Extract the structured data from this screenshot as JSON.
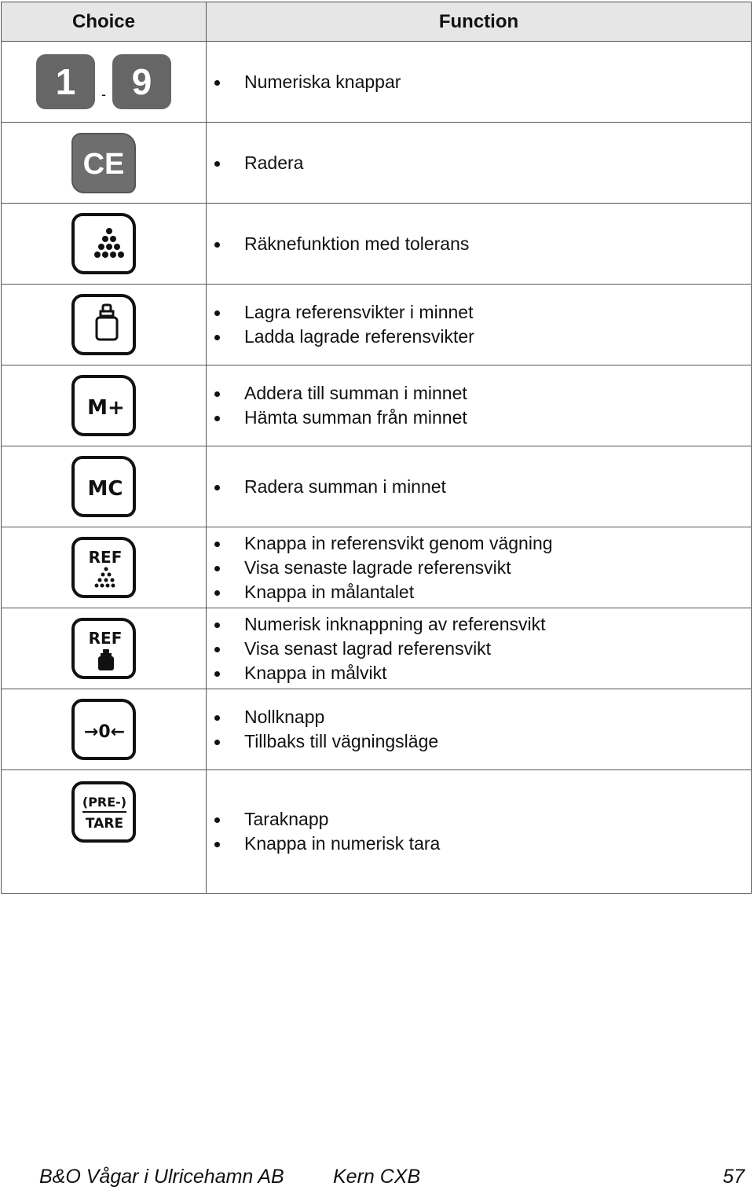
{
  "table": {
    "headers": {
      "choice": "Choice",
      "function": "Function"
    },
    "rows": [
      {
        "key": "numeric-keys",
        "icon_labels": [
          "1",
          "9"
        ],
        "separator": "-",
        "functions": [
          "Numeriska knappar"
        ]
      },
      {
        "key": "ce",
        "icon_label": "CE",
        "functions": [
          "Radera"
        ]
      },
      {
        "key": "counting-tolerance",
        "icon": "pyramid-dots-icon",
        "functions": [
          "Räknefunktion med tolerans"
        ]
      },
      {
        "key": "reference-weight-memory",
        "icon": "weight-outline-icon",
        "functions": [
          "Lagra referensvikter i minnet",
          "Ladda lagrade referensvikter"
        ]
      },
      {
        "key": "m-plus",
        "icon_label": "M+",
        "functions": [
          "Addera till summan i minnet",
          "Hämta summan från minnet"
        ]
      },
      {
        "key": "mc",
        "icon_label": "MC",
        "functions": [
          "Radera summan i minnet"
        ]
      },
      {
        "key": "ref-count",
        "icon_label": "REF",
        "icon": "pyramid-dots-icon",
        "functions": [
          "Knappa in referensvikt genom vägning",
          "Visa senaste lagrade referensvikt",
          "Knappa in målantalet"
        ]
      },
      {
        "key": "ref-weight",
        "icon_label": "REF",
        "icon": "weight-solid-icon",
        "functions": [
          "Numerisk inknappning av referensvikt",
          "Visa senast lagrad referensvikt",
          "Knappa in målvikt"
        ]
      },
      {
        "key": "zero",
        "icon_label": "→0←",
        "functions": [
          "Nollknapp",
          "Tillbaks till vägningsläge"
        ]
      },
      {
        "key": "pre-tare",
        "icon_labels": [
          "(PRE-)",
          "TARE"
        ],
        "functions": [
          "Taraknapp",
          "Knappa in numerisk tara"
        ]
      }
    ]
  },
  "footer": {
    "company": "B&O Vågar i Ulricehamn AB",
    "model": "Kern CXB",
    "page_number": "57"
  }
}
